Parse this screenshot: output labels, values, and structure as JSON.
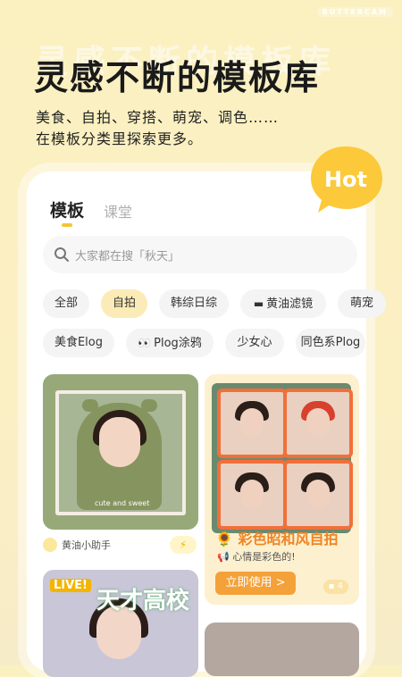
{
  "brand": "BUTTERCAM",
  "headline": "灵感不断的模板库",
  "headline_shadow": "灵感不断的模板库",
  "subtitle_line1": "美食、自拍、穿搭、萌宠、调色……",
  "subtitle_line2": "在模板分类里探索更多。",
  "hot_badge": "Hot",
  "tabs": [
    {
      "label": "模板",
      "active": true
    },
    {
      "label": "课堂",
      "active": false
    }
  ],
  "search": {
    "placeholder": "大家都在搜「秋天」"
  },
  "chips_row1": [
    {
      "label": "全部",
      "active": false,
      "icon": ""
    },
    {
      "label": "自拍",
      "active": true,
      "icon": ""
    },
    {
      "label": "韩综日综",
      "active": false,
      "icon": ""
    },
    {
      "label": "黄油滤镜",
      "active": false,
      "icon": "butter-icon"
    },
    {
      "label": "萌宠",
      "active": false,
      "icon": ""
    }
  ],
  "chips_row2": [
    {
      "label": "美食Elog",
      "active": false,
      "icon": ""
    },
    {
      "label": "Plog涂鸦",
      "active": false,
      "icon": "eyes-icon"
    },
    {
      "label": "少女心",
      "active": false,
      "icon": ""
    },
    {
      "label": "同色系Plog",
      "active": false,
      "icon": ""
    }
  ],
  "template1": {
    "author": "黄油小助手",
    "action_icon": "lightning-icon",
    "photo_caption": "cute and sweet"
  },
  "template2": {
    "title": "彩色昭和风自拍",
    "subtitle": "心情是彩色的!",
    "button": "立即使用 >",
    "comment_count": "4",
    "title_icon": "sunflower-icon"
  },
  "template3": {
    "badge": "LIVE!",
    "headline_chars": "天才高校"
  },
  "colors": {
    "accent": "#f2c534",
    "hot_bubble": "#fbc93a",
    "use_button": "#f5a13a",
    "title_orange": "#f08423"
  }
}
